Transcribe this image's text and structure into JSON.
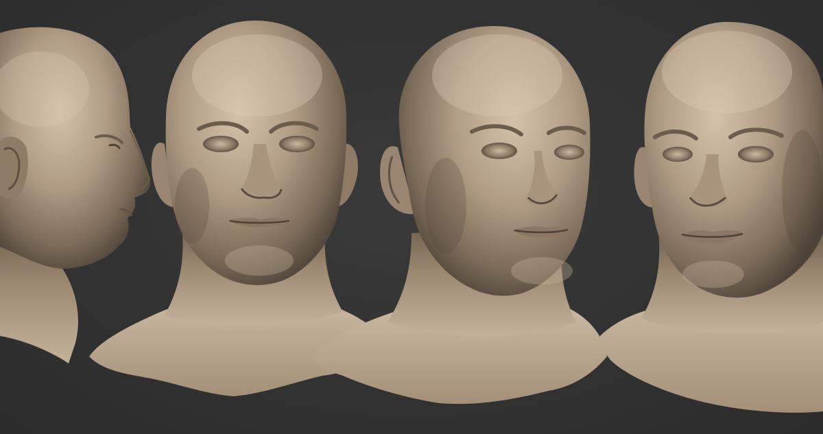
{
  "scene": {
    "background_color": "#333333",
    "material_color": "#a8957f",
    "views": [
      {
        "id": "profile-left",
        "description_name": "head-bust-profile-view"
      },
      {
        "id": "front",
        "description_name": "head-bust-front-view"
      },
      {
        "id": "three-quarter-right",
        "description_name": "head-bust-three-quarter-view"
      },
      {
        "id": "three-quarter-left",
        "description_name": "head-bust-three-quarter-view-alt"
      }
    ]
  }
}
